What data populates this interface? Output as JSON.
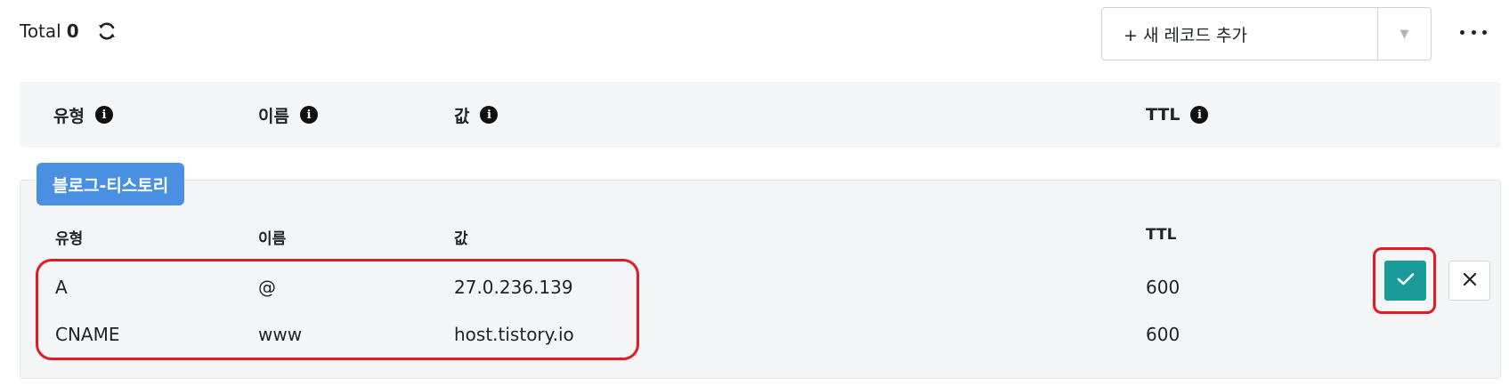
{
  "toolbar": {
    "total_label": "Total",
    "total_count": "0",
    "add_record_label": "+ 새 레코드 추가",
    "dropdown_caret": "▼"
  },
  "table_header": {
    "type": "유형",
    "name": "이름",
    "value": "값",
    "ttl": "TTL",
    "info_glyph": "i"
  },
  "group": {
    "badge": "블로그-티스토리",
    "columns": {
      "type": "유형",
      "name": "이름",
      "value": "값",
      "ttl": "TTL"
    },
    "records": [
      {
        "type": "A",
        "name": "@",
        "value": "27.0.236.139",
        "ttl": "600"
      },
      {
        "type": "CNAME",
        "name": "www",
        "value": "host.tistory.io",
        "ttl": "600"
      }
    ]
  },
  "colors": {
    "badge": "#4a90e2",
    "confirm": "#1a9b9a",
    "highlight": "#e01b24",
    "header_bg": "#f4f5f7"
  },
  "icons": {
    "refresh": "refresh-icon",
    "more": "more-horizontal-icon",
    "info": "info-icon",
    "confirm": "check-icon",
    "cancel": "close-icon"
  }
}
